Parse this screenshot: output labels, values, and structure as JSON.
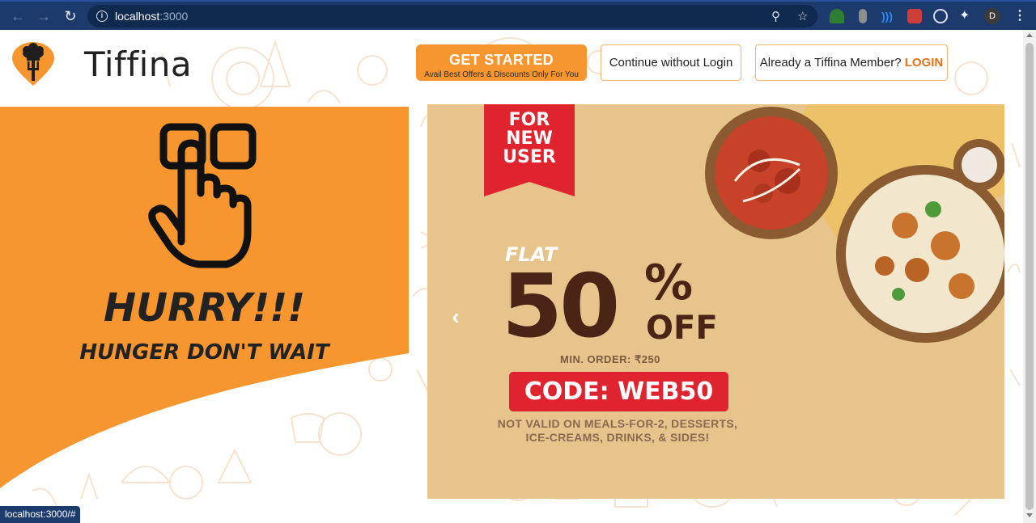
{
  "browser": {
    "url_host": "localhost",
    "url_port": ":3000",
    "profile_initial": "D"
  },
  "header": {
    "brand": "Tiffina",
    "get_started": {
      "title": "GET STARTED",
      "subtitle": "Avail Best Offers & Discounts Only For You"
    },
    "continue_without_login": "Continue without Login",
    "member_prompt": "Already a Tiffina Member?",
    "login_label": "LOGIN"
  },
  "hero": {
    "headline": "HURRY!!!",
    "subheadline": "HUNGER DON'T WAIT"
  },
  "banner": {
    "ribbon_line1": "FOR",
    "ribbon_line2": "NEW",
    "ribbon_line3": "USER",
    "flat": "FLAT",
    "discount_number": "50",
    "percent_sign": "%",
    "off": "OFF",
    "min_order": "MIN. ORDER: ₹250",
    "code": "CODE: WEB50",
    "terms_line1": "NOT VALID ON MEALS-FOR-2, DESSERTS,",
    "terms_line2": "ICE-CREAMS, DRINKS, & SIDES!"
  },
  "status_bar": "localhost:3000/#",
  "colors": {
    "accent_orange": "#f7962f",
    "login_orange": "#e8711a",
    "code_red": "#e0242f",
    "chrome_blue": "#1c3a6b"
  }
}
